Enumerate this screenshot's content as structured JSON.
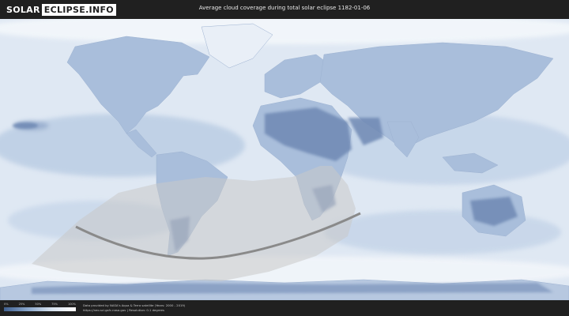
{
  "header": {
    "logo_part1": "SOLAR",
    "logo_part2": "ECLIPSE.INFO",
    "title": "Average cloud coverage during total solar eclipse 1182-01-06"
  },
  "legend": {
    "ticks": [
      "0%",
      "25%",
      "50%",
      "75%",
      "100%"
    ],
    "gradient_colors": [
      "#40608f",
      "#8aa7cc",
      "#d9e4f0",
      "#ffffff"
    ]
  },
  "footer": {
    "credit_line1": "Data provided by NASA's Aqua & Terra satellite (Years: 2000 - 2019)",
    "credit_line2": "https://neo.sci.gsfc.nasa.gov | Resolution: 0.1 degrees"
  },
  "colors": {
    "ocean_cloud": "#dfe8f3",
    "land_clear": "#6e88b3",
    "path": "#8a8a8a",
    "shadow": "#c9c9c9"
  }
}
